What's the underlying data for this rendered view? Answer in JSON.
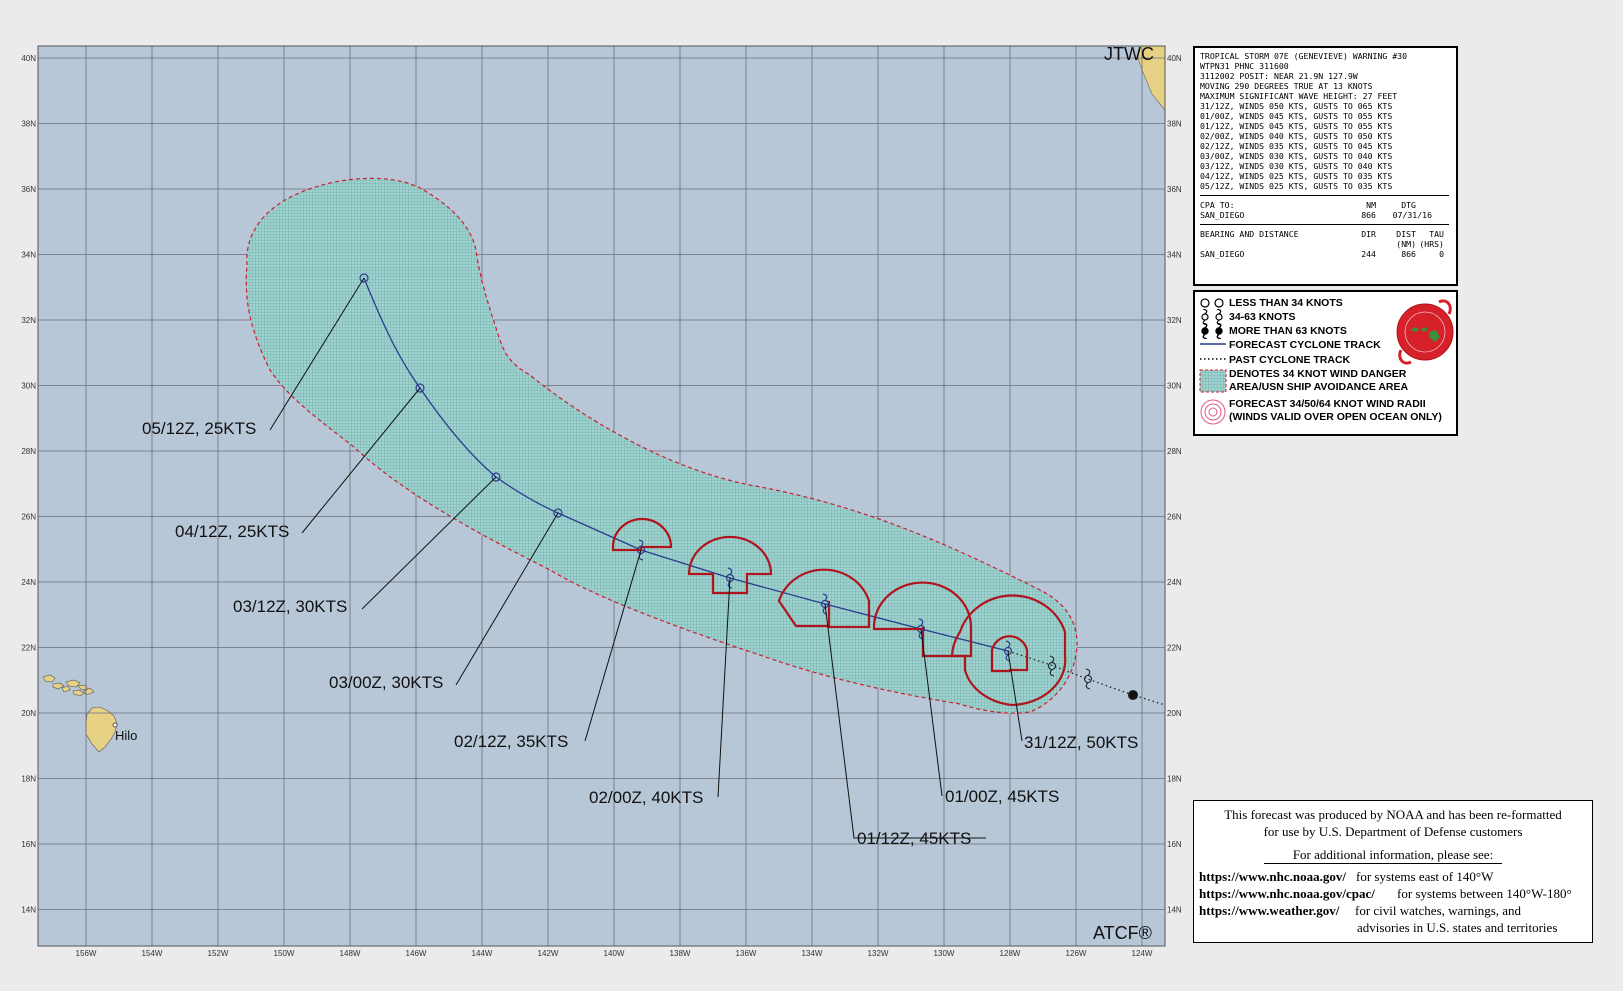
{
  "map": {
    "agency_label": "JTWC",
    "footer_label": "ATCF®",
    "lon_ticks": [
      "156W",
      "154W",
      "152W",
      "150W",
      "148W",
      "146W",
      "144W",
      "142W",
      "140W",
      "138W",
      "136W",
      "134W",
      "132W",
      "130W",
      "128W",
      "126W",
      "124W"
    ],
    "lat_ticks": [
      "40N",
      "38N",
      "36N",
      "34N",
      "32N",
      "30N",
      "28N",
      "26N",
      "24N",
      "22N",
      "20N",
      "18N",
      "16N",
      "14N"
    ],
    "city": "Hilo",
    "forecast_labels": [
      "05/12Z,  25KTS",
      "04/12Z,  25KTS",
      "03/12Z,  30KTS",
      "03/00Z,  30KTS",
      "02/12Z,  35KTS",
      "02/00Z,  40KTS",
      "01/12Z,  45KTS",
      "01/00Z,  45KTS",
      "31/12Z,  50KTS"
    ],
    "colors": {
      "ocean": "#b7c7d8",
      "land": "#e7d184",
      "grid": "#6b6f78",
      "danger_fill": "#9ed3cf",
      "danger_border": "#cc1f2f",
      "track": "#2c3c8c",
      "wind_radii": "#b0141c"
    }
  },
  "warning": {
    "header_lines": [
      "TROPICAL STORM 07E (GENEVIEVE) WARNING #30",
      "WTPN31 PHNC 311600",
      "3112002 POSIT: NEAR 21.9N 127.9W",
      "MOVING 290 DEGREES TRUE AT 13 KNOTS",
      "MAXIMUM SIGNIFICANT WAVE HEIGHT: 27 FEET",
      "31/12Z, WINDS 050 KTS, GUSTS TO 065 KTS",
      "01/00Z, WINDS 045 KTS, GUSTS TO 055 KTS",
      "01/12Z, WINDS 045 KTS, GUSTS TO 055 KTS",
      "02/00Z, WINDS 040 KTS, GUSTS TO 050 KTS",
      "02/12Z, WINDS 035 KTS, GUSTS TO 045 KTS",
      "03/00Z, WINDS 030 KTS, GUSTS TO 040 KTS",
      "03/12Z, WINDS 030 KTS, GUSTS TO 040 KTS",
      "04/12Z, WINDS 025 KTS, GUSTS TO 035 KTS",
      "05/12Z, WINDS 025 KTS, GUSTS TO 035 KTS"
    ],
    "cpa_label": "CPA TO:",
    "cpa_nm_header": "NM",
    "cpa_dtg_header": "DTG",
    "cpa_place": "SAN_DIEGO",
    "cpa_nm": "866",
    "cpa_dtg": "07/31/16",
    "bd_label": "BEARING AND DISTANCE",
    "bd_dir_header": "DIR",
    "bd_dist_header": "DIST",
    "bd_dist_unit": "(NM)",
    "bd_tau_header": "TAU",
    "bd_tau_unit": "(HRS)",
    "bd_place": "SAN_DIEGO",
    "bd_dir": "244",
    "bd_dist": "866",
    "bd_tau": "0"
  },
  "legend": {
    "less_34": "LESS THAN 34 KNOTS",
    "range_34_63": "34-63 KNOTS",
    "more_63": "MORE THAN 63 KNOTS",
    "forecast_track": "FORECAST CYCLONE TRACK",
    "past_track": "PAST CYCLONE TRACK",
    "danger_area_1": "DENOTES 34 KNOT WIND DANGER",
    "danger_area_2": "AREA/USN SHIP AVOIDANCE AREA",
    "wind_radii_1": "FORECAST 34/50/64 KNOT WIND RADII",
    "wind_radii_2": "(WINDS VALID OVER OPEN OCEAN ONLY)"
  },
  "info": {
    "line1": "This forecast was produced by NOAA and has been re-formatted",
    "line2": "for use by U.S. Department of Defense customers",
    "line3": "For additional information, please see:",
    "link1": "https://www.nhc.noaa.gov/",
    "link1_desc": "for systems east of 140°W",
    "link2": "https://www.nhc.noaa.gov/cpac/",
    "link2_desc": "for systems between 140°W-180°",
    "link3": "https://www.weather.gov/",
    "link3_desc_1": "for civil watches, warnings, and",
    "link3_desc_2": "advisories in U.S. states and territories"
  }
}
